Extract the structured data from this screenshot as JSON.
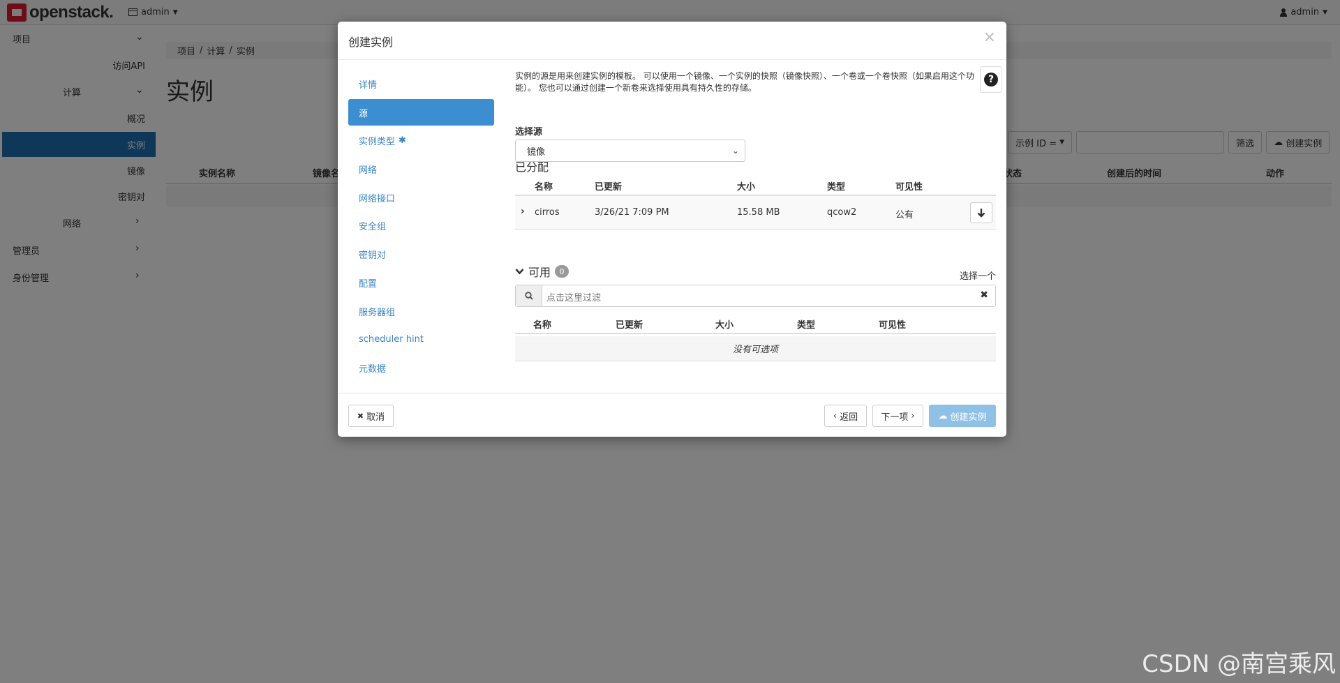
{
  "topbar": {
    "logo_text": "openstack.",
    "project": "admin",
    "user": "admin"
  },
  "sidebar": {
    "items": [
      {
        "label": "项目"
      },
      {
        "label": "访问API"
      },
      {
        "label": "计算"
      },
      {
        "label": "概况"
      },
      {
        "label": "实例"
      },
      {
        "label": "镜像"
      },
      {
        "label": "密钥对"
      },
      {
        "label": "网络"
      },
      {
        "label": "管理员"
      },
      {
        "label": "身份管理"
      }
    ]
  },
  "breadcrumb": [
    "项目",
    "计算",
    "实例"
  ],
  "page": {
    "title": "实例",
    "filter_dropdown": "示例 ID =",
    "filter_btn": "筛选",
    "create_btn": "创建实例",
    "columns": [
      "实例名称",
      "镜像名",
      "状态",
      "创建后的时间",
      "动作"
    ]
  },
  "modal": {
    "title": "创建实例",
    "close": "×",
    "nav": [
      {
        "label": "详情"
      },
      {
        "label": "源"
      },
      {
        "label": "实例类型",
        "required": "✱"
      },
      {
        "label": "网络"
      },
      {
        "label": "网络接口"
      },
      {
        "label": "安全组"
      },
      {
        "label": "密钥对"
      },
      {
        "label": "配置"
      },
      {
        "label": "服务器组"
      },
      {
        "label": "scheduler hint"
      },
      {
        "label": "元数据"
      }
    ],
    "help_text": "实例的源是用来创建实例的模板。 可以使用一个镜像、一个实例的快照（镜像快照）、一个卷或一个卷快照（如果启用这个功能）。 您也可以通过创建一个新卷来选择使用具有持久性的存储。",
    "select_source_label": "选择源",
    "select_source_value": "镜像",
    "allocated": {
      "title": "已分配",
      "columns": [
        "名称",
        "已更新",
        "大小",
        "类型",
        "可见性"
      ],
      "rows": [
        {
          "name": "cirros",
          "updated": "3/26/21 7:09 PM",
          "size": "15.58 MB",
          "type": "qcow2",
          "visibility": "公有"
        }
      ]
    },
    "available": {
      "title": "可用",
      "count": "0",
      "select_one": "选择一个",
      "filter_placeholder": "点击这里过滤",
      "columns": [
        "名称",
        "已更新",
        "大小",
        "类型",
        "可见性"
      ],
      "empty": "没有可选项"
    },
    "footer": {
      "cancel": "取消",
      "back": "返回",
      "next": "下一项",
      "create": "创建实例"
    }
  },
  "watermark": "CSDN @南宫乘风"
}
